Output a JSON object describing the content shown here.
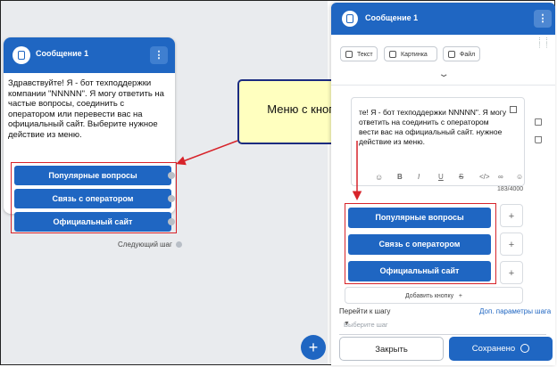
{
  "colors": {
    "accent": "#1f66c2",
    "annotation_red": "#d7232a",
    "callout_fill": "#ffffbf",
    "callout_border": "#1b2b80"
  },
  "node": {
    "title": "Сообщение 1",
    "menu_glyph": "⋮",
    "text": "Здравствуйте! Я - бот техподдержки компании \"NNNNN\". Я могу ответить на частые вопросы, соединить с оператором или перевести вас на официальный сайт. Выберите нужное действие из меню.",
    "buttons": [
      "Популярные вопросы",
      "Связь с оператором",
      "Официальный сайт"
    ],
    "next_step": "Следующий шаг"
  },
  "callout": {
    "text": "Меню с кнопками"
  },
  "fab": {
    "glyph": "+"
  },
  "panel": {
    "title": "Сообщение 1",
    "menu_glyph": "⋮",
    "chips": [
      "Текст",
      "Картинка",
      "Файл"
    ],
    "chevron": "⌄",
    "editor_text": "те! Я - бот техподдержки NNNNN\". Я могу ответить на соединить с оператором вести вас на официальный сайт. нужное действие из меню.",
    "toolbar": [
      "B",
      "I",
      "U",
      "S"
    ],
    "counter": "183/4000",
    "buttons": [
      "Популярные вопросы",
      "Связь с оператором",
      "Официальный сайт"
    ],
    "add_button": "Добавить кнопку",
    "goto_label": "Перейти к шагу",
    "advanced_link": "Доп. параметры шага",
    "select_placeholder": "Выберите шаг",
    "close_label": "Закрыть",
    "save_label": "Сохранено"
  }
}
